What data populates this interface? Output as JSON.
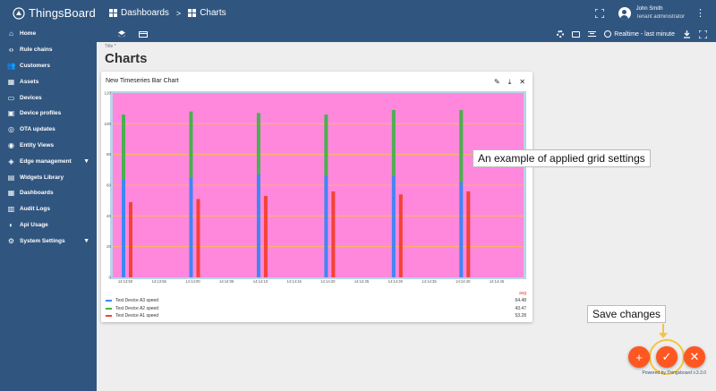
{
  "app": {
    "logo_text": "ThingsBoard"
  },
  "breadcrumb": {
    "first": "Dashboards",
    "separator": ">",
    "second": "Charts"
  },
  "user": {
    "name": "John Smith",
    "role": "Tenant administrator"
  },
  "sidebar": {
    "items": [
      {
        "label": "Home",
        "icon": "home-icon",
        "expandable": false
      },
      {
        "label": "Rule chains",
        "icon": "code-icon",
        "expandable": false
      },
      {
        "label": "Customers",
        "icon": "people-icon",
        "expandable": false
      },
      {
        "label": "Assets",
        "icon": "domain-icon",
        "expandable": false
      },
      {
        "label": "Devices",
        "icon": "devices-icon",
        "expandable": false
      },
      {
        "label": "Device profiles",
        "icon": "device-profile-icon",
        "expandable": false
      },
      {
        "label": "OTA updates",
        "icon": "ota-icon",
        "expandable": false
      },
      {
        "label": "Entity Views",
        "icon": "entity-view-icon",
        "expandable": false
      },
      {
        "label": "Edge management",
        "icon": "edge-icon",
        "expandable": true
      },
      {
        "label": "Widgets Library",
        "icon": "widgets-icon",
        "expandable": false
      },
      {
        "label": "Dashboards",
        "icon": "dashboards-icon",
        "expandable": false
      },
      {
        "label": "Audit Logs",
        "icon": "audit-icon",
        "expandable": false
      },
      {
        "label": "Api Usage",
        "icon": "api-usage-icon",
        "expandable": false
      },
      {
        "label": "System Settings",
        "icon": "settings-icon",
        "expandable": true
      }
    ]
  },
  "toolbar": {
    "time_window": "Realtime - last minute"
  },
  "page": {
    "title_label": "Title *",
    "title": "Charts"
  },
  "widget": {
    "title": "New Timeseries Bar Chart",
    "legend_header": "avg",
    "legend": [
      {
        "name": "Test Device A3 speed",
        "value": "64.48",
        "color": "#4285f4"
      },
      {
        "name": "Test Device A2 speed",
        "value": "43.47",
        "color": "#4caf50"
      },
      {
        "name": "Test Device A1 speed",
        "value": "53.28",
        "color": "#f44336"
      }
    ]
  },
  "chart_data": {
    "type": "bar",
    "background_color": "#ff88dd",
    "grid_color": "#f4c542",
    "grid": true,
    "ylim": [
      0,
      120
    ],
    "y_ticks": [
      "0",
      "20",
      "40",
      "60",
      "80",
      "100",
      "120"
    ],
    "x_ticks": [
      "14:13:50",
      "14:13:55",
      "14:14:00",
      "14:14:05",
      "14:14:10",
      "14:14:15",
      "14:14:20",
      "14:14:25",
      "14:14:30",
      "14:14:35",
      "14:14:40",
      "14:14:45"
    ],
    "series": [
      {
        "name": "Test Device A3 speed",
        "color": "#4285f4",
        "values": [
          64,
          65,
          67,
          66,
          66,
          62
        ]
      },
      {
        "name": "Test Device A2 speed",
        "color": "#4caf50",
        "values": [
          42,
          43,
          40,
          40,
          43,
          47
        ]
      },
      {
        "name": "Test Device A1 speed",
        "color": "#f44336",
        "values": [
          49,
          51,
          53,
          56,
          54,
          56
        ]
      }
    ]
  },
  "annotations": {
    "grid": "An example of applied grid settings",
    "save": "Save changes"
  },
  "footer": {
    "powered": "Powered by Thingsboard v.3.3.0"
  },
  "fabs": {
    "add": "+",
    "save": "✓",
    "close": "✕"
  }
}
